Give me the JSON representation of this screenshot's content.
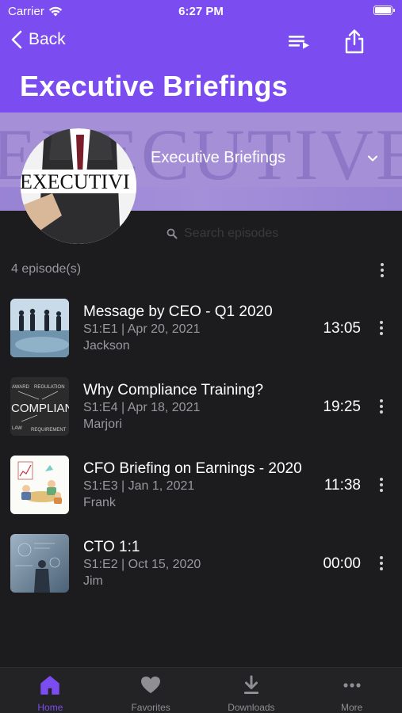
{
  "status_bar": {
    "carrier": "Carrier",
    "time": "6:27 PM"
  },
  "navbar": {
    "back_label": "Back"
  },
  "header": {
    "title": "Executive Briefings"
  },
  "banner": {
    "watermark": "EXECUTIVE",
    "avatar_text": "EXECUTIVI"
  },
  "podcast_selector": {
    "label": "Executive Briefings"
  },
  "search": {
    "placeholder": "Search episodes"
  },
  "list": {
    "count_label": "4 episode(s)"
  },
  "episodes": [
    {
      "title": "Message by CEO - Q1 2020",
      "meta": "S1:E1  | Apr 20, 2021",
      "author": "Jackson",
      "duration": "13:05"
    },
    {
      "title": "Why Compliance Training?",
      "meta": "S1:E4  | Apr 18, 2021",
      "author": "Marjori",
      "duration": "19:25",
      "thumb_text": "COMPLIAN",
      "thumb_words": [
        "AWARD",
        "REGULATION",
        "LAW",
        "REQUIREMENT"
      ]
    },
    {
      "title": "CFO Briefing on Earnings - 2020",
      "meta": "S1:E3  | Jan 1, 2021",
      "author": "Frank",
      "duration": "11:38"
    },
    {
      "title": "CTO 1:1",
      "meta": "S1:E2  | Oct 15, 2020",
      "author": "Jim",
      "duration": "00:00"
    }
  ],
  "tabs": [
    {
      "label": "Home",
      "icon": "home-icon",
      "active": true
    },
    {
      "label": "Favorites",
      "icon": "heart-icon",
      "active": false
    },
    {
      "label": "Downloads",
      "icon": "download-icon",
      "active": false
    },
    {
      "label": "More",
      "icon": "ellipsis-icon",
      "active": false
    }
  ],
  "colors": {
    "accent": "#7b4df0",
    "background": "#1c1c1e",
    "secondary_text": "#98989d"
  }
}
